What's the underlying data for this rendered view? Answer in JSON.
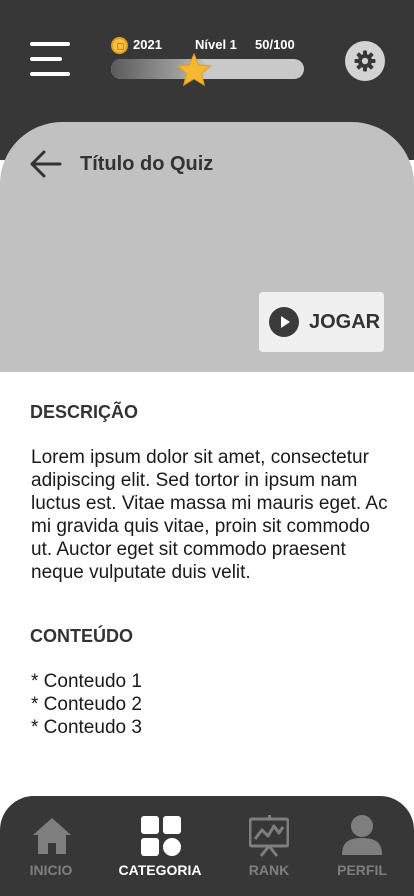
{
  "header": {
    "coins": "2021",
    "level": "Nível 1",
    "xp": "50/100",
    "xp_progress": 0.5,
    "menu_icon": "hamburger-menu-icon",
    "coin_icon": "coin-icon",
    "star_icon": "star-icon",
    "settings_icon": "gear-icon"
  },
  "quiz": {
    "title": "Título do Quiz",
    "back_icon": "arrow-left-icon",
    "play_label": "JOGAR",
    "play_icon": "play-icon"
  },
  "description": {
    "heading": "DESCRIÇÃO",
    "text": "Lorem ipsum dolor sit amet, consectetur adipiscing elit. Sed tortor in ipsum nam luctus est. Vitae massa mi mauris eget. Ac mi gravida quis vitae, proin sit commodo ut. Auctor eget sit commodo praesent neque vulputate duis velit."
  },
  "content": {
    "heading": "CONTEÚDO",
    "items": [
      "* Conteudo 1",
      "* Conteudo 2",
      "* Conteudo 3"
    ]
  },
  "nav": {
    "items": [
      {
        "label": "INICIO",
        "icon": "home-icon",
        "active": false
      },
      {
        "label": "CATEGORIA",
        "icon": "category-icon",
        "active": true
      },
      {
        "label": "RANK",
        "icon": "rank-chart-icon",
        "active": false
      },
      {
        "label": "PERFIL",
        "icon": "profile-icon",
        "active": false
      }
    ]
  },
  "colors": {
    "dark": "#373737",
    "hero": "#c1c1c1",
    "coin": "#f5c042",
    "star": "#f6b832"
  }
}
